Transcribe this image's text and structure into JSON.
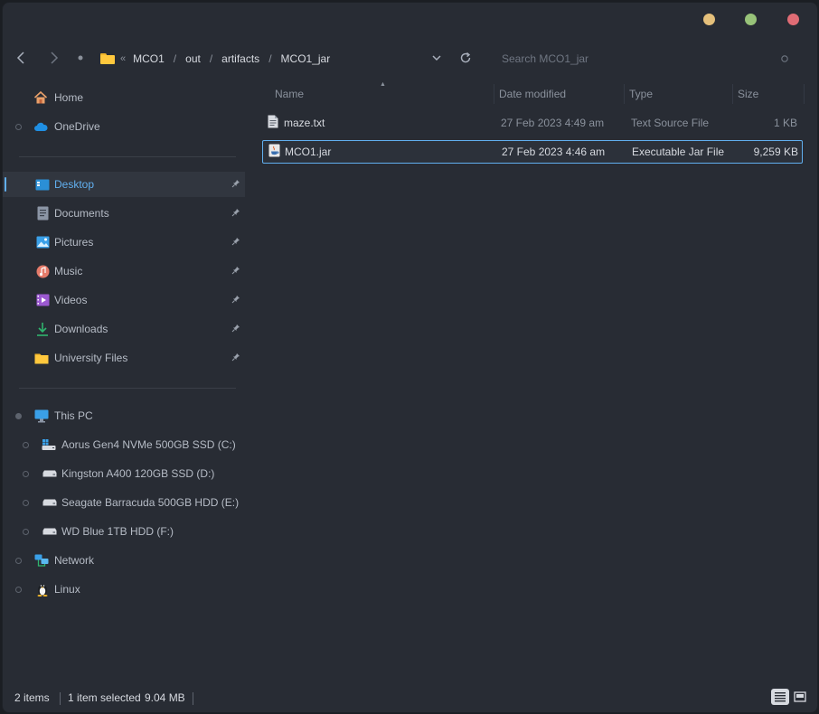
{
  "navigation": {
    "back_icon": "arrow-left-icon",
    "forward_icon": "arrow-right-icon",
    "recent_icon": "dot-icon",
    "refresh_icon": "refresh-icon"
  },
  "breadcrumb": {
    "overflow": "«",
    "parts": [
      "MCO1",
      "out",
      "artifacts",
      "MCO1_jar"
    ],
    "separator": "/"
  },
  "search": {
    "placeholder": "Search MCO1_jar"
  },
  "sidebar": {
    "quick": [
      {
        "label": "Home",
        "icon": "home-icon"
      },
      {
        "label": "OneDrive",
        "icon": "cloud-icon"
      }
    ],
    "pinned": [
      {
        "label": "Desktop",
        "icon": "desktop-icon"
      },
      {
        "label": "Documents",
        "icon": "document-icon"
      },
      {
        "label": "Pictures",
        "icon": "picture-icon"
      },
      {
        "label": "Music",
        "icon": "music-icon"
      },
      {
        "label": "Videos",
        "icon": "video-icon"
      },
      {
        "label": "Downloads",
        "icon": "download-icon"
      },
      {
        "label": "University Files",
        "icon": "folder-icon"
      }
    ],
    "this_pc": {
      "label": "This PC",
      "icon": "monitor-icon"
    },
    "drives": [
      {
        "label": "Aorus Gen4 NVMe 500GB SSD (C:)",
        "icon": "system-drive-icon"
      },
      {
        "label": "Kingston A400 120GB SSD (D:)",
        "icon": "drive-icon"
      },
      {
        "label": "Seagate Barracuda 500GB HDD (E:)",
        "icon": "drive-icon"
      },
      {
        "label": "WD Blue 1TB HDD (F:)",
        "icon": "drive-icon"
      }
    ],
    "network": {
      "label": "Network",
      "icon": "network-icon"
    },
    "linux": {
      "label": "Linux",
      "icon": "linux-penguin-icon"
    }
  },
  "columns": {
    "name": "Name",
    "date": "Date modified",
    "type": "Type",
    "size": "Size"
  },
  "files": [
    {
      "name": "maze.txt",
      "date": "27 Feb 2023 4:49 am",
      "type": "Text Source File",
      "size": "1 KB",
      "icon": "text-file-icon"
    },
    {
      "name": "MCO1.jar",
      "date": "27 Feb 2023 4:46 am",
      "type": "Executable Jar File",
      "size": "9,259 KB",
      "icon": "java-jar-icon"
    }
  ],
  "status": {
    "count": "2 items",
    "selected": "1 item selected",
    "selected_size": "9.04 MB"
  },
  "colors": {
    "accent": "#61afef",
    "background": "#282c34"
  }
}
